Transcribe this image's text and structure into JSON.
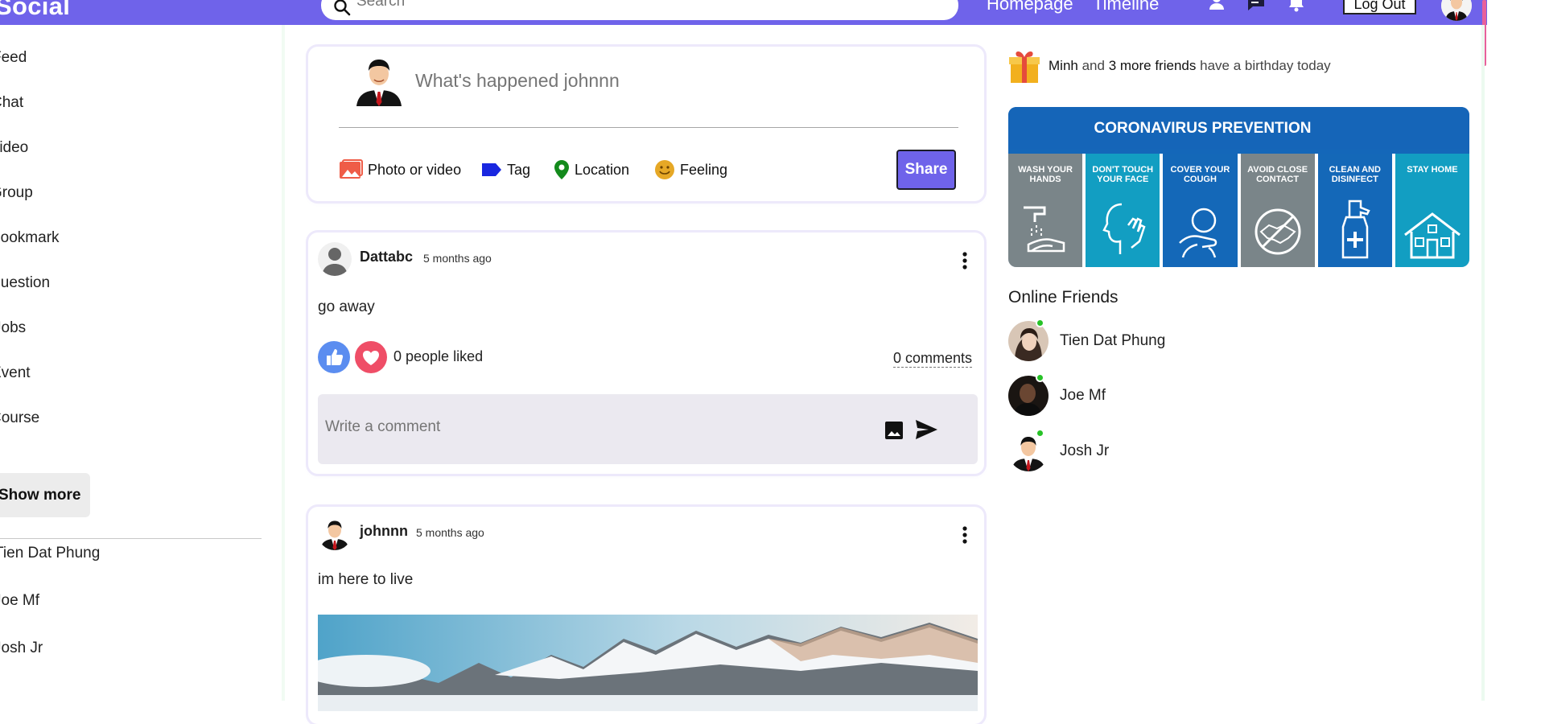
{
  "topbar": {
    "logo": "Social",
    "search_placeholder": "Search",
    "nav": [
      "Homepage",
      "Timeline"
    ],
    "icons": [
      "person-icon",
      "chat-icon",
      "bell-icon"
    ],
    "logout_label": "Log Out",
    "accent": "#6f63ea"
  },
  "sidebar": {
    "items": [
      "Feed",
      "Chat",
      "Video",
      "Group",
      "Bookmark",
      "Question",
      "Jobs",
      "Event",
      "Course"
    ],
    "show_more": "Show more",
    "friends": [
      "Tien Dat Phung",
      "Joe Mf",
      "Josh Jr"
    ]
  },
  "composer": {
    "placeholder": "What's happened johnnn",
    "actions": [
      "Photo or video",
      "Tag",
      "Location",
      "Feeling"
    ],
    "share_label": "Share"
  },
  "posts": [
    {
      "author": "Dattabc",
      "time": "5 months ago",
      "text": "go away",
      "likes": "0 people liked",
      "comments": "0 comments",
      "comment_placeholder": "Write a comment"
    },
    {
      "author": "johnnn",
      "time": "5 months ago",
      "text": "im here to live"
    }
  ],
  "rightbar": {
    "birthday": {
      "name": "Minh",
      "mid": "and",
      "friends": "3 more friends",
      "tail": "have a birthday today"
    },
    "covid": {
      "title": "CORONAVIRUS PREVENTION",
      "tiles": [
        "WASH YOUR HANDS",
        "DON'T TOUCH YOUR FACE",
        "COVER YOUR COUGH",
        "AVOID CLOSE CONTACT",
        "CLEAN AND DISINFECT",
        "STAY HOME"
      ]
    },
    "online_title": "Online Friends",
    "online": [
      "Tien Dat Phung",
      "Joe Mf",
      "Josh Jr"
    ]
  }
}
